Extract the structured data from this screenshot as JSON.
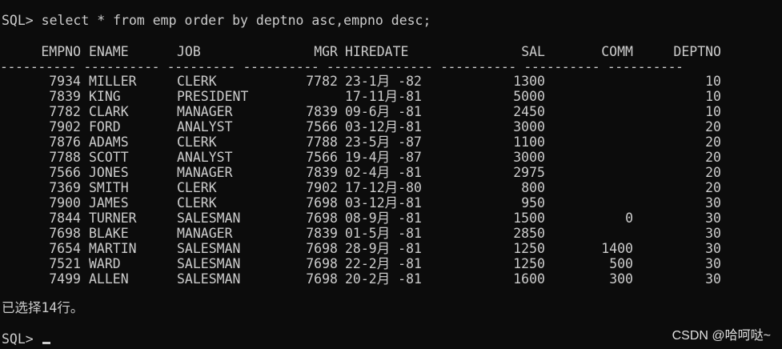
{
  "terminal": {
    "command_line": "SQL> select * from emp order by deptno asc,empno desc;",
    "columns": [
      "EMPNO",
      "ENAME",
      "JOB",
      "MGR",
      "HIREDATE",
      "SAL",
      "COMM",
      "DEPTNO"
    ],
    "separator": "---------- ---------- --------- ---------- -------------- ---------- ---------- ----------",
    "rows": [
      [
        "7934",
        "MILLER",
        "CLERK",
        "7782",
        "23-1月 -82",
        "1300",
        "",
        "10"
      ],
      [
        "7839",
        "KING",
        "PRESIDENT",
        "",
        "17-11月-81",
        "5000",
        "",
        "10"
      ],
      [
        "7782",
        "CLARK",
        "MANAGER",
        "7839",
        "09-6月 -81",
        "2450",
        "",
        "10"
      ],
      [
        "7902",
        "FORD",
        "ANALYST",
        "7566",
        "03-12月-81",
        "3000",
        "",
        "20"
      ],
      [
        "7876",
        "ADAMS",
        "CLERK",
        "7788",
        "23-5月 -87",
        "1100",
        "",
        "20"
      ],
      [
        "7788",
        "SCOTT",
        "ANALYST",
        "7566",
        "19-4月 -87",
        "3000",
        "",
        "20"
      ],
      [
        "7566",
        "JONES",
        "MANAGER",
        "7839",
        "02-4月 -81",
        "2975",
        "",
        "20"
      ],
      [
        "7369",
        "SMITH",
        "CLERK",
        "7902",
        "17-12月-80",
        "800",
        "",
        "20"
      ],
      [
        "7900",
        "JAMES",
        "CLERK",
        "7698",
        "03-12月-81",
        "950",
        "",
        "30"
      ],
      [
        "7844",
        "TURNER",
        "SALESMAN",
        "7698",
        "08-9月 -81",
        "1500",
        "0",
        "30"
      ],
      [
        "7698",
        "BLAKE",
        "MANAGER",
        "7839",
        "01-5月 -81",
        "2850",
        "",
        "30"
      ],
      [
        "7654",
        "MARTIN",
        "SALESMAN",
        "7698",
        "28-9月 -81",
        "1250",
        "1400",
        "30"
      ],
      [
        "7521",
        "WARD",
        "SALESMAN",
        "7698",
        "22-2月 -81",
        "1250",
        "500",
        "30"
      ],
      [
        "7499",
        "ALLEN",
        "SALESMAN",
        "7698",
        "20-2月 -81",
        "1600",
        "300",
        "30"
      ]
    ],
    "summary": "已选择14行。",
    "prompt": "SQL>"
  },
  "watermark": "CSDN @哈呵哒~",
  "colors": {
    "background": "#0c0c0c",
    "text": "#cccccc"
  }
}
